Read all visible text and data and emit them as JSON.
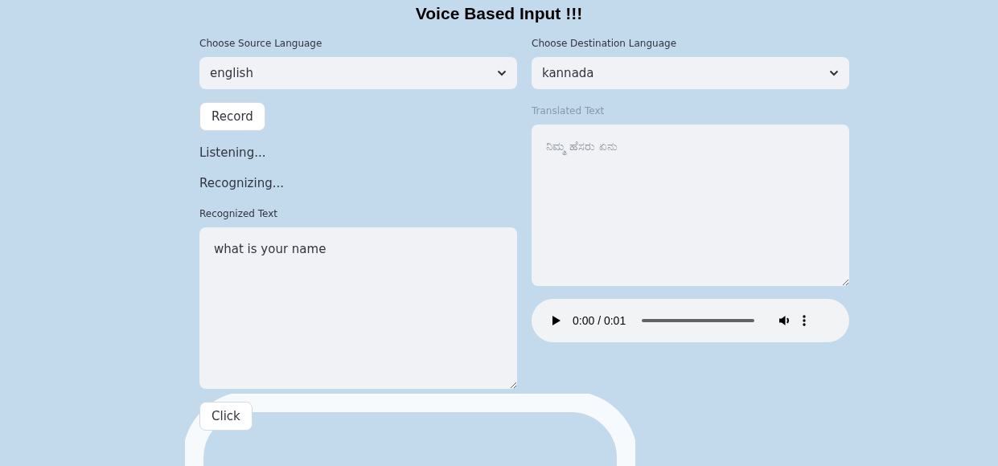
{
  "title": "Voice Based Input !!!",
  "source": {
    "label": "Choose Source Language",
    "value": "english"
  },
  "record_button": "Record",
  "status_lines": [
    "Listening...",
    "Recognizing..."
  ],
  "recognized": {
    "label": "Recognized Text",
    "value": "what is your name",
    "disabled": false
  },
  "click_button": "Click",
  "destination": {
    "label": "Choose Destination Language",
    "value": "kannada"
  },
  "translated": {
    "label": "Translated Text",
    "value": "ನಿಮ್ಮ ಹೆಸರು ಏನು",
    "disabled": true
  },
  "audio": {
    "time": "0:00 / 0:01"
  }
}
